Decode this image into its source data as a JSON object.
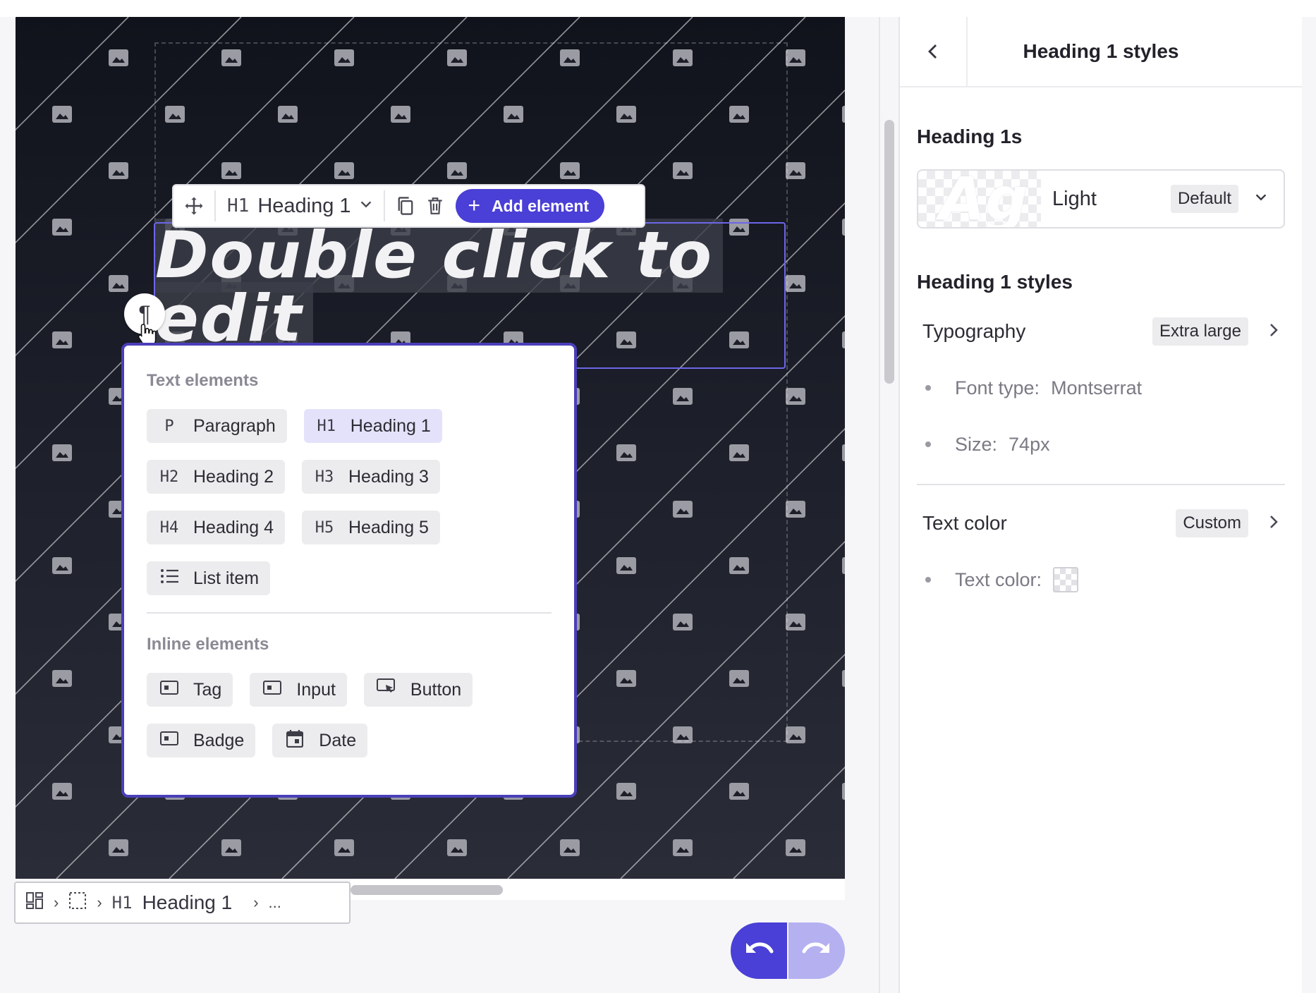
{
  "toolbar": {
    "element_tag": "H1",
    "element_type": "Heading 1",
    "add_label": "Add element"
  },
  "canvas": {
    "heading_line1": "Double click to",
    "heading_line2": "edit"
  },
  "popover": {
    "text_section_title": "Text elements",
    "text_elements": [
      {
        "tag": "P",
        "label": "Paragraph"
      },
      {
        "tag": "H1",
        "label": "Heading 1",
        "active": true
      },
      {
        "tag": "H2",
        "label": "Heading 2"
      },
      {
        "tag": "H3",
        "label": "Heading 3"
      },
      {
        "tag": "H4",
        "label": "Heading 4"
      },
      {
        "tag": "H5",
        "label": "Heading 5"
      },
      {
        "tag": "",
        "label": "List item"
      }
    ],
    "inline_section_title": "Inline elements",
    "inline_elements": [
      {
        "icon": "tag-icon",
        "label": "Tag"
      },
      {
        "icon": "input-icon",
        "label": "Input"
      },
      {
        "icon": "button-icon",
        "label": "Button"
      },
      {
        "icon": "badge-icon",
        "label": "Badge"
      },
      {
        "icon": "calendar-icon",
        "label": "Date"
      }
    ]
  },
  "breadcrumb": {
    "tag": "H1",
    "label": "Heading 1",
    "more": "..."
  },
  "panel": {
    "title": "Heading 1 styles",
    "font_section_title": "Heading 1s",
    "font_preview": "Ag",
    "font_name": "Light",
    "font_badge": "Default",
    "styles_section_title": "Heading 1 styles",
    "typography_label": "Typography",
    "typography_value": "Extra large",
    "font_type_label": "Font type:",
    "font_type_value": "Montserrat",
    "size_label": "Size:",
    "size_value": "74px",
    "text_color_label": "Text color",
    "text_color_value": "Custom",
    "text_color_item_label": "Text color:"
  },
  "colors": {
    "accent": "#4a3fd6",
    "accent_light": "#b5b0f0",
    "chip_active": "#e4e2fb"
  }
}
